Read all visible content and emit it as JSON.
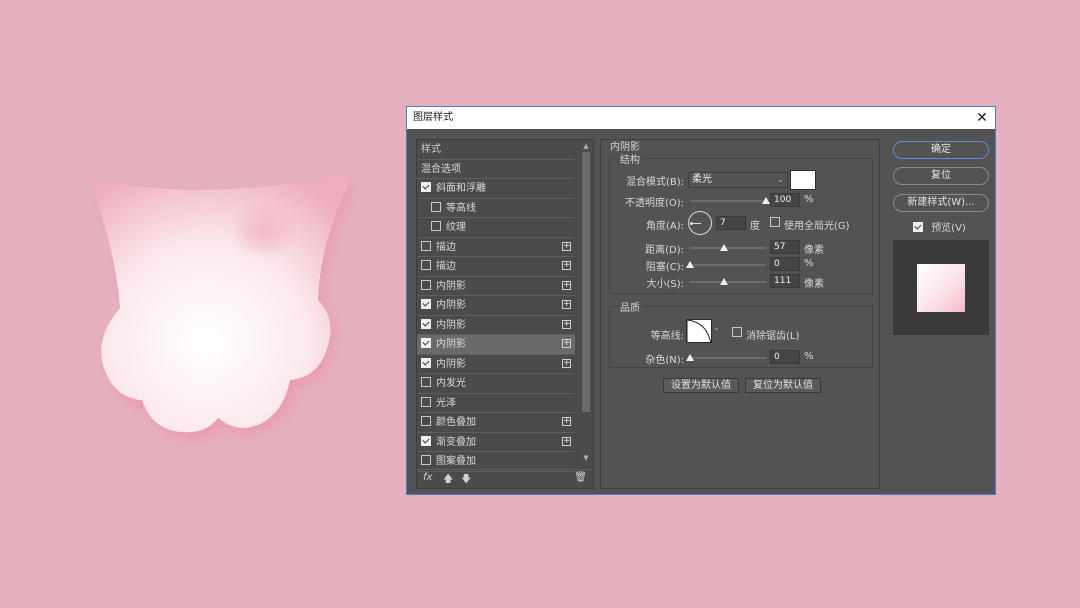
{
  "dialog": {
    "title": "图层样式",
    "close_glyph": "✕"
  },
  "styles_list": {
    "header": "样式",
    "blend_options": "混合选项",
    "items": [
      {
        "label": "斜面和浮雕",
        "checked": true,
        "plus": false,
        "sub": false
      },
      {
        "label": "等高线",
        "checked": false,
        "plus": false,
        "sub": true
      },
      {
        "label": "纹理",
        "checked": false,
        "plus": false,
        "sub": true
      },
      {
        "label": "描边",
        "checked": false,
        "plus": true,
        "sub": false
      },
      {
        "label": "描边",
        "checked": false,
        "plus": true,
        "sub": false
      },
      {
        "label": "内阴影",
        "checked": false,
        "plus": true,
        "sub": false
      },
      {
        "label": "内阴影",
        "checked": true,
        "plus": true,
        "sub": false
      },
      {
        "label": "内阴影",
        "checked": true,
        "plus": true,
        "sub": false
      },
      {
        "label": "内阴影",
        "checked": true,
        "plus": true,
        "sub": false,
        "selected": true
      },
      {
        "label": "内阴影",
        "checked": true,
        "plus": true,
        "sub": false
      },
      {
        "label": "内发光",
        "checked": false,
        "plus": false,
        "sub": false
      },
      {
        "label": "光泽",
        "checked": false,
        "plus": false,
        "sub": false
      },
      {
        "label": "颜色叠加",
        "checked": false,
        "plus": true,
        "sub": false
      },
      {
        "label": "渐变叠加",
        "checked": true,
        "plus": true,
        "sub": false
      },
      {
        "label": "图案叠加",
        "checked": false,
        "plus": false,
        "sub": false
      }
    ],
    "footer": {
      "fx": "fx",
      "up": "🡅",
      "down": "🡇",
      "trash": "🗑"
    }
  },
  "inner_shadow": {
    "panel_title": "内阴影",
    "structure_title": "结构",
    "blend_mode_label": "混合模式(B):",
    "blend_mode_value": "柔光",
    "shadow_color": "#ffffff",
    "opacity_label": "不透明度(O):",
    "opacity_value": "100",
    "opacity_fraction": 1.0,
    "percent": "%",
    "angle_label": "角度(A):",
    "angle_value": "7",
    "angle_unit": "度",
    "global_light_label": "使用全局光(G)",
    "global_light_checked": false,
    "distance_label": "距离(D):",
    "distance_value": "57",
    "distance_fraction": 0.45,
    "choke_label": "阻塞(C):",
    "choke_value": "0",
    "choke_fraction": 0.0,
    "size_label": "大小(S):",
    "size_value": "111",
    "size_fraction": 0.45,
    "px_unit": "像素",
    "quality_title": "品质",
    "contour_label": "等高线:",
    "anti_alias_label": "消除锯齿(L)",
    "anti_alias_checked": false,
    "noise_label": "杂色(N):",
    "noise_value": "0",
    "noise_fraction": 0.0,
    "make_default": "设置为默认值",
    "reset_default": "复位为默认值"
  },
  "actions": {
    "ok": "确定",
    "reset": "复位",
    "new_style": "新建样式(W)...",
    "preview_label": "预览(V)",
    "preview_checked": true
  },
  "colors": {
    "canvas_bg": "#e5b0bd",
    "dialog_bg": "#535353",
    "accent": "#5b8bd6"
  }
}
